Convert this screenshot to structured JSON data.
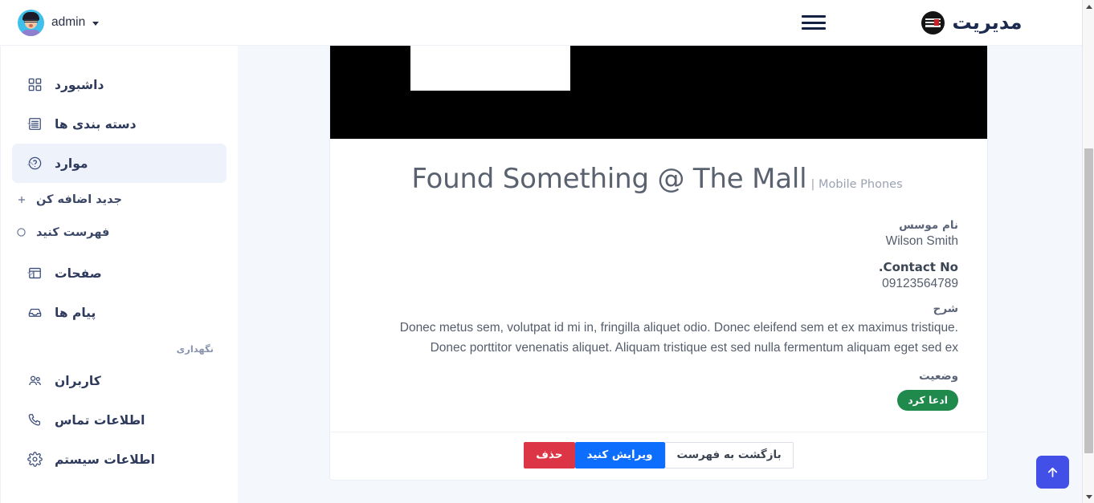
{
  "brand": {
    "title": "مدیریت",
    "logo_icon": "lost-found-logo-icon"
  },
  "topbar": {
    "menu_toggle_icon": "hamburger-menu-icon",
    "user": {
      "name": "admin",
      "avatar_icon": "user-avatar-icon",
      "caret_icon": "chevron-down-icon"
    }
  },
  "sidebar": {
    "items": [
      {
        "label": "داشبورد",
        "icon": "grid-dashboard-icon",
        "expandable": false,
        "active": false
      },
      {
        "label": "دسته بندی ها",
        "icon": "layers-list-icon",
        "expandable": true,
        "expanded": false,
        "active": false
      },
      {
        "label": "موارد",
        "icon": "question-circle-icon",
        "expandable": true,
        "expanded": true,
        "active": true
      },
      {
        "label": "صفحات",
        "icon": "layout-page-icon",
        "expandable": true,
        "expanded": false,
        "active": false
      },
      {
        "label": "پیام ها",
        "icon": "inbox-icon",
        "expandable": false,
        "active": false
      }
    ],
    "subitems": [
      {
        "label": "جدید اضافه کن",
        "icon": "plus-icon"
      },
      {
        "label": "فهرست کنید",
        "icon": "circle-icon"
      }
    ],
    "section_label": "نگهداری",
    "maintenance_items": [
      {
        "label": "کاربران",
        "icon": "users-icon"
      },
      {
        "label": "اطلاعات تماس",
        "icon": "phone-icon"
      },
      {
        "label": "اطلاعات سیستم",
        "icon": "gear-icon"
      }
    ]
  },
  "item": {
    "image_alt": "ink-splatter-image",
    "title": "Found Something @ The Mall",
    "category_separator": "|",
    "category": "Mobile Phones",
    "fields": {
      "founder_label": "نام موسس",
      "founder_value": "Wilson Smith",
      "contact_label": ".Contact No",
      "contact_value": "09123564789",
      "description_label": "شرح",
      "description_value": "Donec metus sem, volutpat id mi in, fringilla aliquet odio. Donec eleifend sem et ex maximus tristique. Donec porttitor venenatis aliquet. Aliquam tristique est sed nulla fermentum aliquam eget sed ex",
      "status_label": "وضعیت",
      "status_value": "ادعا کرد"
    }
  },
  "actions": {
    "delete_label": "حذف",
    "edit_label": "ویرایش کنید",
    "back_label": "بازگشت به فهرست"
  },
  "scroll_top": {
    "icon": "arrow-up-icon"
  },
  "colors": {
    "brand_text": "#1b2a4e",
    "sidebar_active_bg": "#eef2fb",
    "content_bg": "#f4f7fc",
    "status_badge": "#1f8a4c",
    "primary_button": "#0d6efd",
    "danger_button": "#dc3545",
    "scroll_top_button": "#4250e8"
  }
}
